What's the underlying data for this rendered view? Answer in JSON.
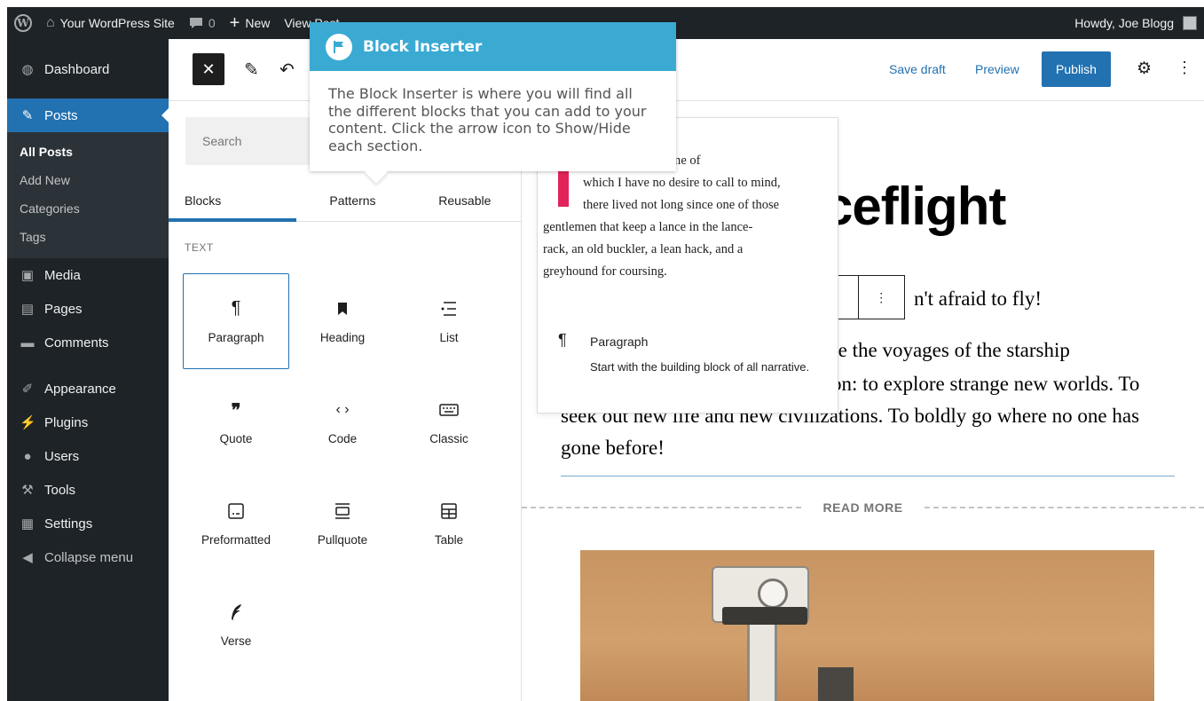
{
  "admin_bar": {
    "site_name": "Your WordPress Site",
    "comments_count": "0",
    "new_label": "New",
    "view_post_label": "View Post",
    "greeting": "Howdy, Joe Blogg"
  },
  "sidebar": {
    "items_top": [
      {
        "label": "Dashboard",
        "icon": "dashboard-icon"
      },
      {
        "label": "Posts",
        "icon": "pin-icon"
      }
    ],
    "posts_submenu": [
      "All Posts",
      "Add New",
      "Categories",
      "Tags"
    ],
    "items_bottom": [
      {
        "label": "Media",
        "icon": "media-icon"
      },
      {
        "label": "Pages",
        "icon": "pages-icon"
      },
      {
        "label": "Comments",
        "icon": "comment-icon"
      },
      {
        "label": "Appearance",
        "icon": "brush-icon"
      },
      {
        "label": "Plugins",
        "icon": "plug-icon"
      },
      {
        "label": "Users",
        "icon": "users-icon"
      },
      {
        "label": "Tools",
        "icon": "wrench-icon"
      },
      {
        "label": "Settings",
        "icon": "settings-icon"
      },
      {
        "label": "Collapse menu",
        "icon": "collapse-icon"
      }
    ]
  },
  "header": {
    "save_draft": "Save draft",
    "preview": "Preview",
    "publish": "Publish"
  },
  "inserter": {
    "search_placeholder": "Search",
    "tabs": [
      "Blocks",
      "Patterns",
      "Reusable"
    ],
    "section_title": "TEXT",
    "blocks": [
      {
        "label": "Paragraph",
        "icon": "paragraph-icon"
      },
      {
        "label": "Heading",
        "icon": "bookmark-icon"
      },
      {
        "label": "List",
        "icon": "list-icon"
      },
      {
        "label": "Quote",
        "icon": "quote-icon"
      },
      {
        "label": "Code",
        "icon": "code-icon"
      },
      {
        "label": "Classic",
        "icon": "keyboard-icon"
      },
      {
        "label": "Preformatted",
        "icon": "preformatted-icon"
      },
      {
        "label": "Pullquote",
        "icon": "pullquote-icon"
      },
      {
        "label": "Table",
        "icon": "table-icon"
      },
      {
        "label": "Verse",
        "icon": "feather-icon"
      }
    ]
  },
  "tooltip": {
    "title": "Block Inserter",
    "body": "The Block Inserter is where you will find all the different blocks that you can add to your content. Click the arrow icon to Show/Hide each section."
  },
  "preview": {
    "text_first": "a Mancha, the name of",
    "text_lines": [
      "which I have no desire to call to mind,",
      "there lived not long since one of those",
      "gentlemen that keep a lance in the lance-",
      "rack, an old buckler, a lean hack, and a",
      "greyhound for coursing."
    ],
    "block_name": "Paragraph",
    "block_desc": "Start with the building block of all narrative."
  },
  "canvas": {
    "title_fragment": "ceflight",
    "subtitle_fragment": "n't afraid to fly!",
    "body_lines": [
      "re the voyages of the starship",
      "on: to explore strange new worlds. To",
      "seek out new life and new civilizations. To boldly go where no one has",
      "gone before!"
    ],
    "read_more": "READ MORE"
  }
}
